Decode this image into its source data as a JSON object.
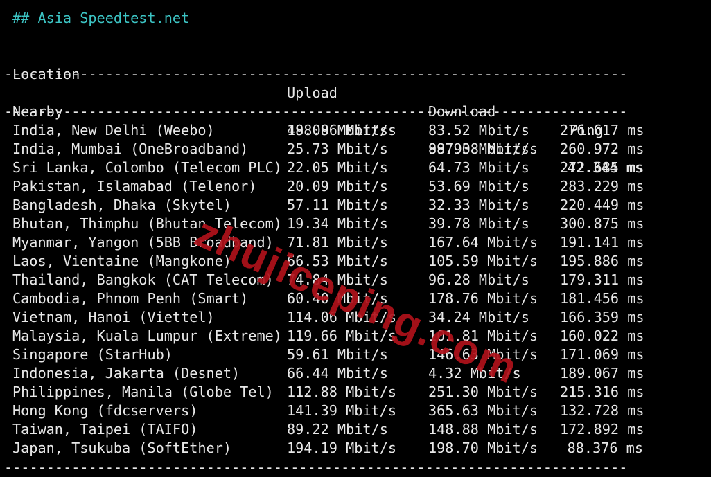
{
  "heading": "## Asia Speedtest.net",
  "columns": {
    "location": "Location",
    "upload": "Upload",
    "download": "Download",
    "ping": "Ping"
  },
  "separator": "--------------------------------------------------------------------------------------------------------------------",
  "nearby": {
    "location": "Nearby",
    "upload": "488.96 Mbit/s",
    "download": "887.08 Mbit/s",
    "ping": "42.344 ms"
  },
  "rows": [
    {
      "location": "India, New Delhi (Weebo)",
      "upload": "19.08 Mbit/s",
      "download": "83.52 Mbit/s",
      "ping": "276.617 ms"
    },
    {
      "location": "India, Mumbai (OneBroadband)",
      "upload": "25.73 Mbit/s",
      "download": "99.93 Mbit/s",
      "ping": "260.972 ms"
    },
    {
      "location": "Sri Lanka, Colombo (Telecom PLC)",
      "upload": "22.05 Mbit/s",
      "download": "64.73 Mbit/s",
      "ping": "272.685 ms"
    },
    {
      "location": "Pakistan, Islamabad (Telenor)",
      "upload": "20.09 Mbit/s",
      "download": "53.69 Mbit/s",
      "ping": "283.229 ms"
    },
    {
      "location": "Bangladesh, Dhaka (Skytel)",
      "upload": "57.11 Mbit/s",
      "download": "32.33 Mbit/s",
      "ping": "220.449 ms"
    },
    {
      "location": "Bhutan, Thimphu (Bhutan Telecom)",
      "upload": "19.34 Mbit/s",
      "download": "39.78 Mbit/s",
      "ping": "300.875 ms"
    },
    {
      "location": "Myanmar, Yangon (5BB Broadband)",
      "upload": "71.81 Mbit/s",
      "download": "167.64 Mbit/s",
      "ping": "191.141 ms"
    },
    {
      "location": "Laos, Vientaine (Mangkone)",
      "upload": "66.53 Mbit/s",
      "download": "105.59 Mbit/s",
      "ping": "195.886 ms"
    },
    {
      "location": "Thailand, Bangkok (CAT Telecom)",
      "upload": "74.84 Mbit/s",
      "download": "96.28 Mbit/s",
      "ping": "179.311 ms"
    },
    {
      "location": "Cambodia, Phnom Penh (Smart)",
      "upload": "60.40 Mbit/s",
      "download": "178.76 Mbit/s",
      "ping": "181.456 ms"
    },
    {
      "location": "Vietnam, Hanoi (Viettel)",
      "upload": "114.06 Mbit/s",
      "download": "34.24 Mbit/s",
      "ping": "166.359 ms"
    },
    {
      "location": "Malaysia, Kuala Lumpur (Extreme)",
      "upload": "119.66 Mbit/s",
      "download": "101.81 Mbit/s",
      "ping": "160.022 ms"
    },
    {
      "location": "Singapore (StarHub)",
      "upload": "59.61 Mbit/s",
      "download": "146.63 Mbit/s",
      "ping": "171.069 ms"
    },
    {
      "location": "Indonesia, Jakarta (Desnet)",
      "upload": "66.44 Mbit/s",
      "download": "4.32 Mbit/s",
      "ping": "189.067 ms"
    },
    {
      "location": "Philippines, Manila (Globe Tel)",
      "upload": "112.88 Mbit/s",
      "download": "251.30 Mbit/s",
      "ping": "215.316 ms"
    },
    {
      "location": "Hong Kong (fdcservers)",
      "upload": "141.39 Mbit/s",
      "download": "365.63 Mbit/s",
      "ping": "132.728 ms"
    },
    {
      "location": "Taiwan, Taipei (TAIFO)",
      "upload": "89.22 Mbit/s",
      "download": "148.88 Mbit/s",
      "ping": "172.892 ms"
    },
    {
      "location": "Japan, Tsukuba (SoftEther)",
      "upload": "194.19 Mbit/s",
      "download": "198.70 Mbit/s",
      "ping": "88.376 ms"
    }
  ],
  "watermark": "zhujiceping.com",
  "colors": {
    "background": "#000000",
    "text": "#e8e8e8",
    "heading": "#3cc4c4",
    "watermark": "#b0121b"
  }
}
